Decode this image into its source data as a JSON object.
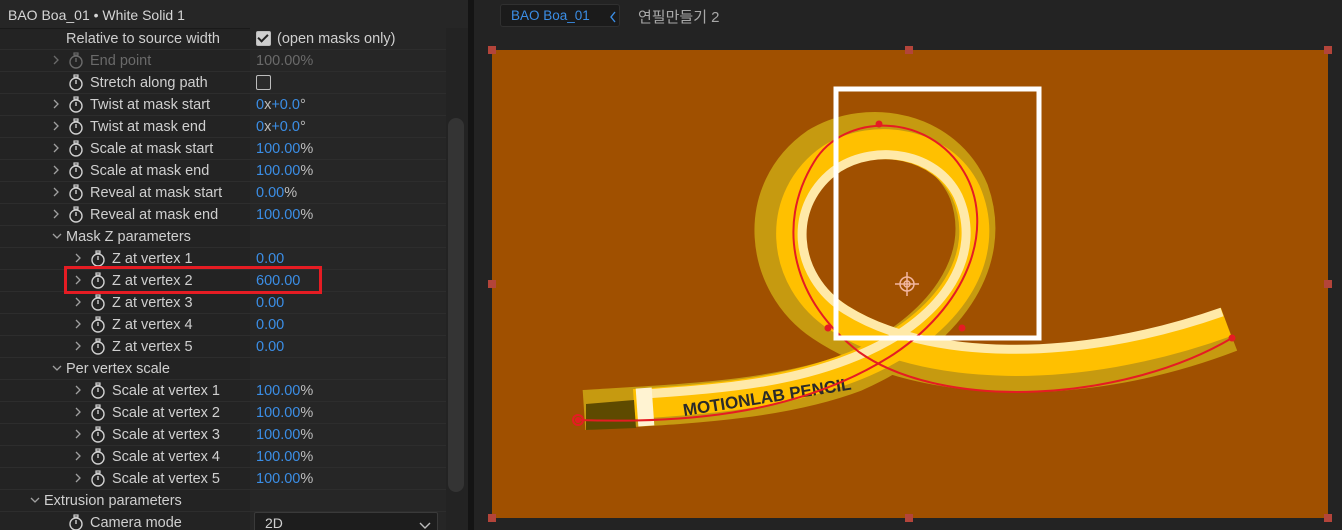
{
  "panel": {
    "title": "BAO Boa_01 • White Solid 1",
    "relative_source": {
      "label": "Relative to source width",
      "checked": true,
      "note": "(open masks only)"
    },
    "end_point": {
      "label": "End point",
      "value": "100.00%"
    },
    "stretch": {
      "label": "Stretch along path",
      "checked": false
    },
    "twist_start": {
      "label": "Twist at mask start",
      "value_num": "0",
      "value_x": "x",
      "value_deg": "+0.0",
      "value_unit": "°"
    },
    "twist_end": {
      "label": "Twist at mask end",
      "value_num": "0",
      "value_x": "x",
      "value_deg": "+0.0",
      "value_unit": "°"
    },
    "scale_start": {
      "label": "Scale at mask start",
      "value": "100.00",
      "unit": "%"
    },
    "scale_end": {
      "label": "Scale at mask end",
      "value": "100.00",
      "unit": "%"
    },
    "reveal_start": {
      "label": "Reveal at mask start",
      "value": "0.00",
      "unit": "%"
    },
    "reveal_end": {
      "label": "Reveal at mask end",
      "value": "100.00",
      "unit": "%"
    },
    "mask_z": {
      "label": "Mask Z parameters"
    },
    "z_vertices": [
      {
        "label": "Z at vertex 1",
        "value": "0.00"
      },
      {
        "label": "Z at vertex 2",
        "value": "600.00"
      },
      {
        "label": "Z at vertex 3",
        "value": "0.00"
      },
      {
        "label": "Z at vertex 4",
        "value": "0.00"
      },
      {
        "label": "Z at vertex 5",
        "value": "0.00"
      }
    ],
    "per_vertex": {
      "label": "Per vertex scale"
    },
    "scale_vertices": [
      {
        "label": "Scale at vertex 1",
        "value": "100.00",
        "unit": "%"
      },
      {
        "label": "Scale at vertex 2",
        "value": "100.00",
        "unit": "%"
      },
      {
        "label": "Scale at vertex 3",
        "value": "100.00",
        "unit": "%"
      },
      {
        "label": "Scale at vertex 4",
        "value": "100.00",
        "unit": "%"
      },
      {
        "label": "Scale at vertex 5",
        "value": "100.00",
        "unit": "%"
      }
    ],
    "extrusion": {
      "label": "Extrusion parameters"
    },
    "camera_mode": {
      "label": "Camera mode",
      "value": "2D"
    }
  },
  "viewer": {
    "comp_tab": "BAO Boa_01",
    "comp_name": "연필만들기 2",
    "pencil_text": "MOTIONLAB PENCIL",
    "colors": {
      "canvas": "#a05000",
      "accent": "#3b8ee6",
      "highlight": "#e51c23",
      "pencil": "#ffc000"
    }
  }
}
